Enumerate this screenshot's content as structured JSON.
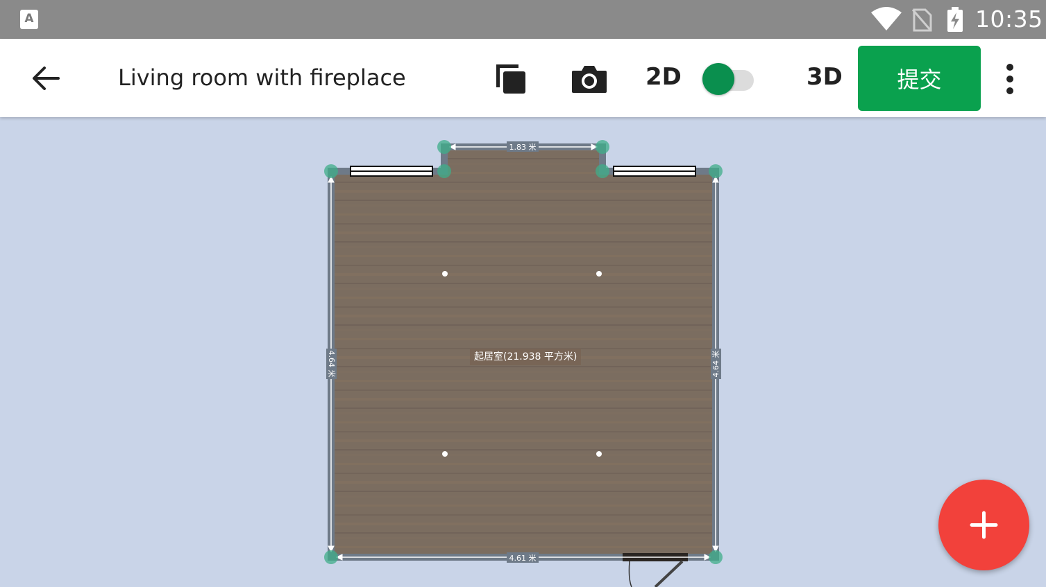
{
  "status_bar": {
    "app_icon_letter": "A",
    "time": "10:35"
  },
  "toolbar": {
    "title": "Living room with fireplace",
    "label_2d": "2D",
    "label_3d": "3D",
    "submit_label": "提交"
  },
  "plan": {
    "room_label": "起居室(21.938 平方米)",
    "dim_top": "1.83 米",
    "dim_bottom": "4.61 米",
    "dim_left": "4.64 米",
    "dim_right": "4.64 米"
  },
  "colors": {
    "accent_green": "#0aa14e",
    "fab_red": "#f2413b",
    "background": "#c9d4e8"
  }
}
